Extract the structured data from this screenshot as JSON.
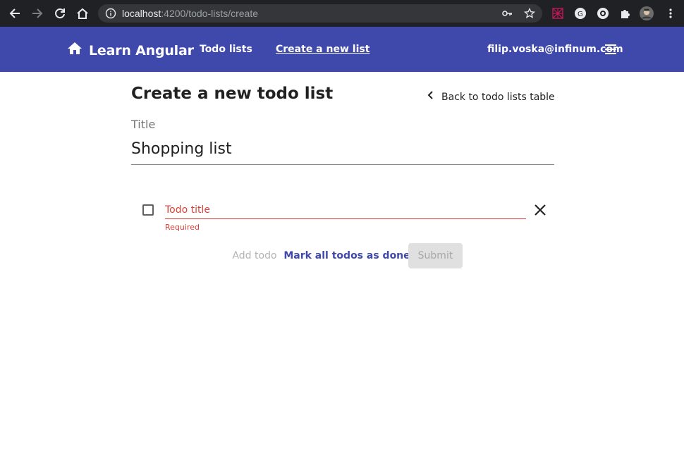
{
  "browser": {
    "url_host": "localhost",
    "url_path": ":4200/todo-lists/create",
    "icons": [
      "back-arrow-icon",
      "forward-arrow-icon",
      "reload-icon",
      "home-icon",
      "info-icon",
      "key-icon",
      "star-icon",
      "extension-grid-icon",
      "translate-icon",
      "extension-circle-icon",
      "puzzle-icon",
      "profile-avatar",
      "kebab-menu-icon"
    ]
  },
  "toolbar": {
    "brand_title": "Learn Angular",
    "nav_todo_lists": "Todo lists",
    "nav_create_list": "Create a new list",
    "user_email": "filip.voska@infinum.com",
    "color": "#3f48ab"
  },
  "main": {
    "page_title": "Create a new todo list",
    "back_link": "Back to todo lists table",
    "title_label": "Title",
    "title_value": "Shopping list",
    "todo": {
      "placeholder": "Todo title",
      "value": "",
      "error": "Required",
      "checked": false
    },
    "buttons": {
      "add_todo": "Add todo",
      "mark_all_done": "Mark all todos as done",
      "submit": "Submit"
    },
    "error_color": "#d9423a"
  }
}
